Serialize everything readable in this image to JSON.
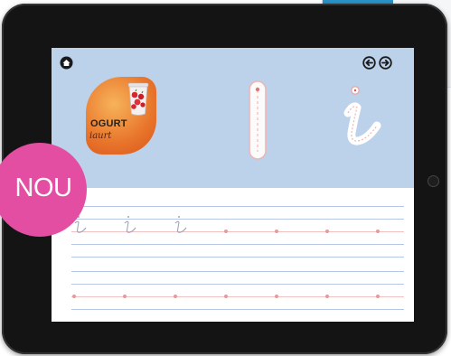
{
  "app": {
    "card": {
      "word": "OGURT",
      "cursive_word": "iaurt"
    },
    "letter": {
      "print": "I",
      "cursive": "i"
    },
    "badge": {
      "text": "NOU"
    }
  },
  "icons": {
    "home": "home-icon",
    "back": "arrow-left-circle-icon",
    "forward": "arrow-right-circle-icon",
    "cup": "yogurt-cup-icon"
  },
  "colors": {
    "header_bg": "#bcd1ea",
    "card_orange": "#e8742a",
    "badge_pink": "#e44ea2",
    "guide_blue": "#b5c7e4",
    "guide_pink": "#f2c1c1",
    "device_black": "#141414"
  }
}
